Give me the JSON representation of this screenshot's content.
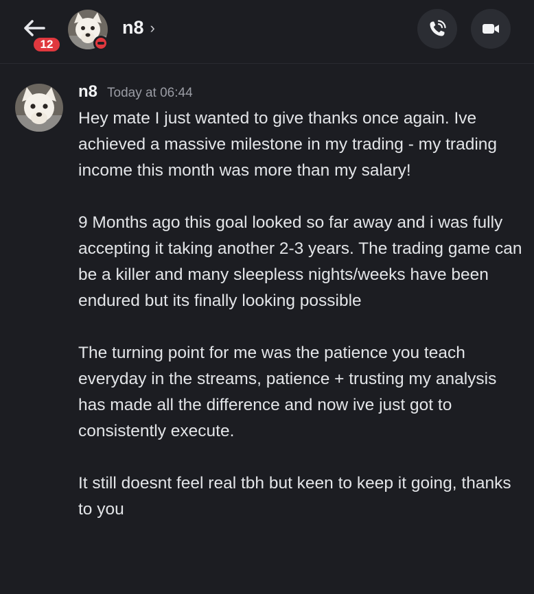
{
  "header": {
    "unread_count": "12",
    "contact_name": "n8",
    "chevron": "›",
    "status": "do-not-disturb",
    "icons": {
      "back": "arrow-left-icon",
      "call": "phone-icon",
      "video": "video-camera-icon"
    }
  },
  "message": {
    "author": "n8",
    "timestamp": "Today at 06:44",
    "paragraphs": [
      "Hey mate I just wanted to give thanks once again. Ive achieved a massive milestone in my trading - my trading income this month was more than my salary!",
      "9 Months ago this goal looked so far away and i was fully accepting it taking another 2-3 years. The trading game can be a killer and many sleepless nights/weeks have been endured but its finally looking possible",
      "The turning point for me was the patience you teach everyday in the streams, patience + trusting my analysis has made all the difference and now ive just got to consistently execute.",
      "It still doesnt feel real tbh but keen to keep it going, thanks to you"
    ]
  },
  "colors": {
    "background": "#1c1d22",
    "badge": "#e0383e",
    "button": "#2b2d33",
    "text": "#e3e5e8",
    "muted": "#9a9ca4"
  }
}
